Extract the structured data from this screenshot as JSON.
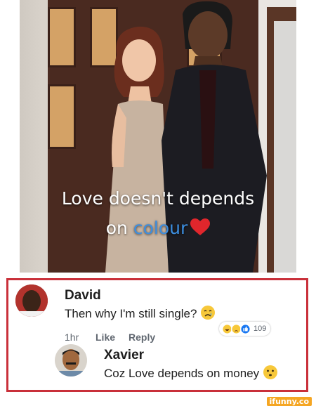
{
  "post": {
    "caption_line1": "Love doesn't depends",
    "caption_line2_before": "on ",
    "caption_line2_highlight": "colour"
  },
  "comments": [
    {
      "author": "David",
      "text": "Then why I'm still single?",
      "time": "1hr",
      "like_label": "Like",
      "reply_label": "Reply",
      "reaction_count": "109",
      "reactions": [
        "haha",
        "sad",
        "like"
      ]
    },
    {
      "author": "Xavier",
      "text": "Coz Love depends on money"
    }
  ],
  "watermark": "ifunny.co",
  "colors": {
    "highlight_blue": "#3c8ee0",
    "border_red": "#c9303a",
    "heart_red": "#e0262c",
    "watermark_bg": "#f5a623"
  }
}
